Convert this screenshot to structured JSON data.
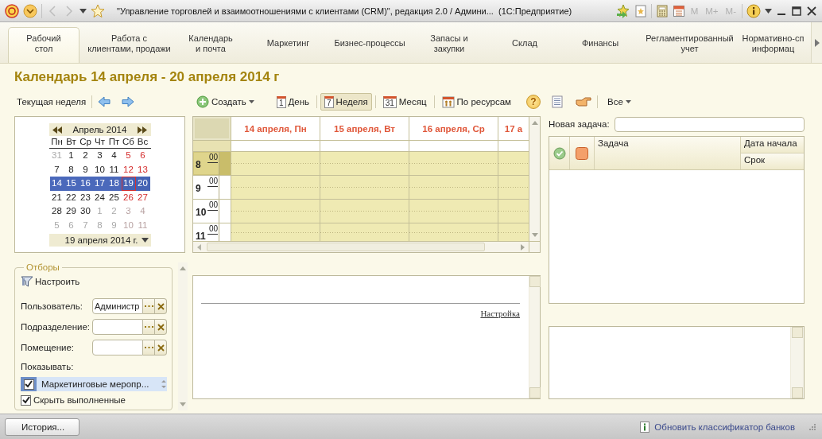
{
  "window": {
    "title": "\"Управление торговлей и взаимоотношениями с клиентами (CRM)\", редакция 2.0 / Админи...  (1С:Предприятие)",
    "memory_buttons": [
      {
        "label": "M",
        "disabled": true
      },
      {
        "label": "M+",
        "disabled": true
      },
      {
        "label": "M-",
        "disabled": true
      }
    ]
  },
  "sections": [
    {
      "label": "Рабочий\nстол",
      "selected": true
    },
    {
      "label": "Работа с\nклиентами, продажи",
      "selected": false
    },
    {
      "label": "Календарь\nи почта",
      "selected": false
    },
    {
      "label": "Маркетинг",
      "selected": false
    },
    {
      "label": "Бизнес-процессы",
      "selected": false
    },
    {
      "label": "Запасы и\nзакупки",
      "selected": false
    },
    {
      "label": "Склад",
      "selected": false
    },
    {
      "label": "Финансы",
      "selected": false
    },
    {
      "label": "Регламентированный\nучет",
      "selected": false
    },
    {
      "label": "Нормативно-сп\nинформац",
      "selected": false
    }
  ],
  "page_title": "Календарь 14 апреля - 20 апреля 2014 г",
  "week_nav": {
    "label": "Текущая неделя"
  },
  "mini_calendar": {
    "month": "Апрель 2014",
    "weekdays": [
      "Пн",
      "Вт",
      "Ср",
      "Чт",
      "Пт",
      "Сб",
      "Вс"
    ],
    "weeks": [
      [
        {
          "day": "31",
          "other_month": true,
          "weekend": false,
          "selected": false,
          "today": false
        },
        {
          "day": "1",
          "other_month": false,
          "weekend": false,
          "selected": false,
          "today": false
        },
        {
          "day": "2",
          "other_month": false,
          "weekend": false,
          "selected": false,
          "today": false
        },
        {
          "day": "3",
          "other_month": false,
          "weekend": false,
          "selected": false,
          "today": false
        },
        {
          "day": "4",
          "other_month": false,
          "weekend": false,
          "selected": false,
          "today": false
        },
        {
          "day": "5",
          "other_month": false,
          "weekend": true,
          "selected": false,
          "today": false
        },
        {
          "day": "6",
          "other_month": false,
          "weekend": true,
          "selected": false,
          "today": false
        }
      ],
      [
        {
          "day": "7",
          "other_month": false,
          "weekend": false,
          "selected": false,
          "today": false
        },
        {
          "day": "8",
          "other_month": false,
          "weekend": false,
          "selected": false,
          "today": false
        },
        {
          "day": "9",
          "other_month": false,
          "weekend": false,
          "selected": false,
          "today": false
        },
        {
          "day": "10",
          "other_month": false,
          "weekend": false,
          "selected": false,
          "today": false
        },
        {
          "day": "11",
          "other_month": false,
          "weekend": false,
          "selected": false,
          "today": false
        },
        {
          "day": "12",
          "other_month": false,
          "weekend": true,
          "selected": false,
          "today": false
        },
        {
          "day": "13",
          "other_month": false,
          "weekend": true,
          "selected": false,
          "today": false
        }
      ],
      [
        {
          "day": "14",
          "other_month": false,
          "weekend": false,
          "selected": true,
          "today": false
        },
        {
          "day": "15",
          "other_month": false,
          "weekend": false,
          "selected": true,
          "today": false
        },
        {
          "day": "16",
          "other_month": false,
          "weekend": false,
          "selected": true,
          "today": false
        },
        {
          "day": "17",
          "other_month": false,
          "weekend": false,
          "selected": true,
          "today": false
        },
        {
          "day": "18",
          "other_month": false,
          "weekend": false,
          "selected": true,
          "today": false
        },
        {
          "day": "19",
          "other_month": false,
          "weekend": true,
          "selected": true,
          "today": true
        },
        {
          "day": "20",
          "other_month": false,
          "weekend": true,
          "selected": true,
          "today": false
        }
      ],
      [
        {
          "day": "21",
          "other_month": false,
          "weekend": false,
          "selected": false,
          "today": false
        },
        {
          "day": "22",
          "other_month": false,
          "weekend": false,
          "selected": false,
          "today": false
        },
        {
          "day": "23",
          "other_month": false,
          "weekend": false,
          "selected": false,
          "today": false
        },
        {
          "day": "24",
          "other_month": false,
          "weekend": false,
          "selected": false,
          "today": false
        },
        {
          "day": "25",
          "other_month": false,
          "weekend": false,
          "selected": false,
          "today": false
        },
        {
          "day": "26",
          "other_month": false,
          "weekend": true,
          "selected": false,
          "today": false
        },
        {
          "day": "27",
          "other_month": false,
          "weekend": true,
          "selected": false,
          "today": false
        }
      ],
      [
        {
          "day": "28",
          "other_month": false,
          "weekend": false,
          "selected": false,
          "today": false
        },
        {
          "day": "29",
          "other_month": false,
          "weekend": false,
          "selected": false,
          "today": false
        },
        {
          "day": "30",
          "other_month": false,
          "weekend": false,
          "selected": false,
          "today": false
        },
        {
          "day": "1",
          "other_month": true,
          "weekend": false,
          "selected": false,
          "today": false
        },
        {
          "day": "2",
          "other_month": true,
          "weekend": false,
          "selected": false,
          "today": false
        },
        {
          "day": "3",
          "other_month": true,
          "weekend": true,
          "selected": false,
          "today": false
        },
        {
          "day": "4",
          "other_month": true,
          "weekend": true,
          "selected": false,
          "today": false
        }
      ],
      [
        {
          "day": "5",
          "other_month": true,
          "weekend": false,
          "selected": false,
          "today": false
        },
        {
          "day": "6",
          "other_month": true,
          "weekend": false,
          "selected": false,
          "today": false
        },
        {
          "day": "7",
          "other_month": true,
          "weekend": false,
          "selected": false,
          "today": false
        },
        {
          "day": "8",
          "other_month": true,
          "weekend": false,
          "selected": false,
          "today": false
        },
        {
          "day": "9",
          "other_month": true,
          "weekend": false,
          "selected": false,
          "today": false
        },
        {
          "day": "10",
          "other_month": true,
          "weekend": true,
          "selected": false,
          "today": false
        },
        {
          "day": "11",
          "other_month": true,
          "weekend": true,
          "selected": false,
          "today": false
        }
      ]
    ],
    "date_field": "19 апреля 2014 г."
  },
  "filters": {
    "title": "Отборы",
    "configure": "Настроить",
    "fields": [
      {
        "label": "Пользователь:",
        "value": "Администр"
      },
      {
        "label": "Подразделение:"
      },
      {
        "label": "Помещение:"
      }
    ],
    "show_label": "Показывать:",
    "show_items": [
      {
        "label": "Маркетинговые меропр...",
        "checked": true,
        "selected": true
      }
    ],
    "hide_completed": {
      "label": "Скрыть выполненные",
      "checked": true
    }
  },
  "scheduler": {
    "create": "Создать",
    "views": [
      {
        "label": "День",
        "icon_text": "1",
        "selected": false
      },
      {
        "label": "Неделя",
        "icon_text": "7",
        "selected": true
      },
      {
        "label": "Месяц",
        "icon_text": "31",
        "selected": false
      },
      {
        "label": "По ресурсам",
        "selected": false
      }
    ],
    "help": "?",
    "days": [
      "14 апреля, Пн",
      "15 апреля, Вт",
      "16 апреля, Ср",
      "17 а"
    ],
    "hours": [
      {
        "hour": "8",
        "minutes": "00",
        "current": true
      },
      {
        "hour": "9",
        "minutes": "00",
        "current": false
      },
      {
        "hour": "10",
        "minutes": "00",
        "current": false
      },
      {
        "hour": "11",
        "minutes": "00",
        "current": false
      }
    ]
  },
  "notes": {
    "link": "Настройка"
  },
  "tasks": {
    "filter": "Все",
    "new_task_label": "Новая задача:",
    "columns": [
      "Задача",
      "Дата начала",
      "Срок"
    ]
  },
  "history_button": "История...",
  "status_link": "Обновить классификатор банков"
}
